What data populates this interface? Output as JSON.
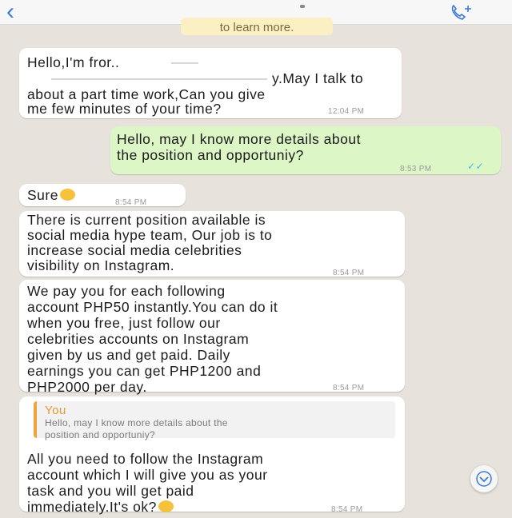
{
  "header": {
    "back_icon": "chevron-left-icon",
    "add_call_icon": "add-call-icon"
  },
  "notice": "to learn more.",
  "messages": [
    {
      "direction": "incoming",
      "lines": [
        "Hello,I'm fror..",
        "y.May I talk to",
        "about a part time work,Can you give",
        "me few minutes of your time?"
      ],
      "time": "12:04 PM"
    },
    {
      "direction": "outgoing",
      "text": "Hello, may I know more details about\nthe position and opportuniy?",
      "time": "8:53 PM"
    },
    {
      "direction": "incoming",
      "text": "Sure",
      "emoji": "smiling-face-emoji",
      "time": "8:54 PM"
    },
    {
      "direction": "incoming",
      "text": "There is current position available is\nsocial media hype team, Our job is to\nincrease social media celebrities\nvisibility on Instagram.",
      "time": "8:54 PM"
    },
    {
      "direction": "incoming",
      "text": "We pay you for each following\naccount PHP50 instantly.You can do it\nwhen you free, just follow our\ncelebrities accounts on Instagram\ngiven by us and get paid. Daily\nearnings you can get PHP1200 and\nPHP2000 per day.",
      "time": "8:54 PM"
    },
    {
      "direction": "incoming",
      "quote": {
        "author": "You",
        "text": "Hello, may I know more details about the\nposition and opportuniy?"
      },
      "text": "All you need to follow the Instagram\naccount which I will give you as your\ntask and you will get paid\nimmediately.It's ok?",
      "emoji": "smiling-face-emoji",
      "time": "8:54 PM"
    }
  ],
  "colors": {
    "incoming": "#ffffff",
    "outgoing": "#dcf6c6",
    "background": "#e7e2dc",
    "accent": "#3a7bd5",
    "quote_bar": "#f0a23c"
  },
  "scroll_down_icon": "chevron-down-icon"
}
